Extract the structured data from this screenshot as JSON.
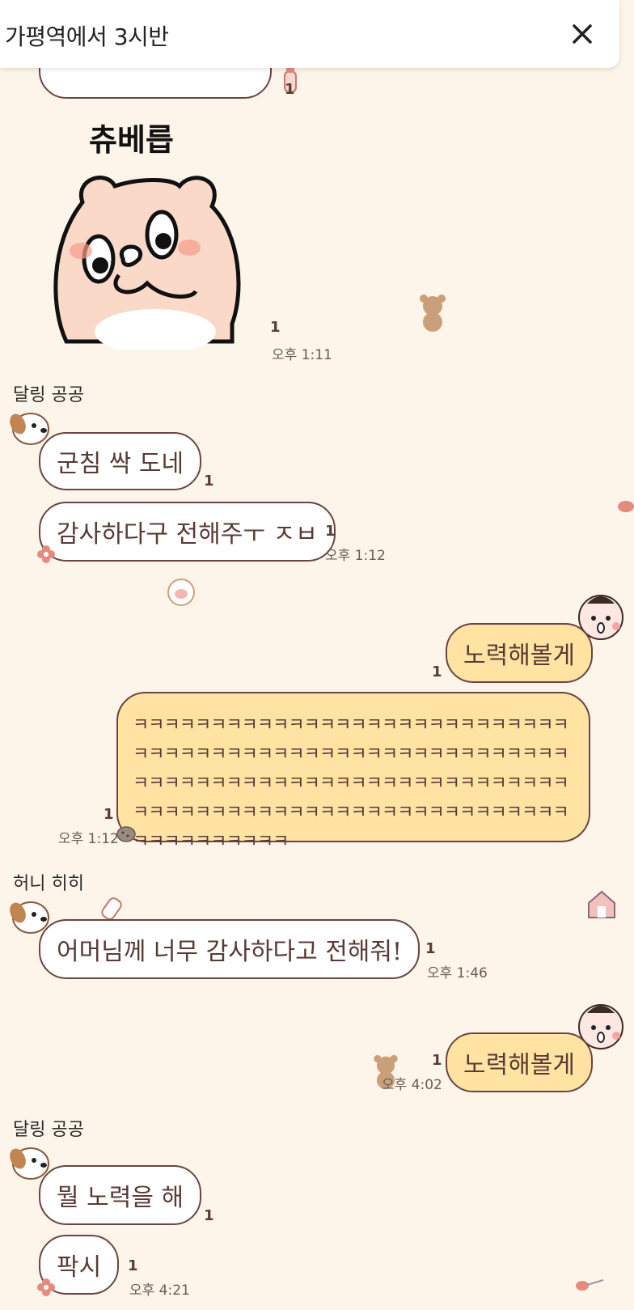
{
  "header": {
    "title": "가평역에서 3시반"
  },
  "sticker": {
    "caption": "츄베릅",
    "unread": "1",
    "time": "오후 1:11"
  },
  "messages": [
    {
      "sender": "달링 공공"
    },
    {
      "text": "군침 싹 도네",
      "unread": "1"
    },
    {
      "text": "감사하다구 전해주ㅜ ㅈㅂ",
      "unread": "1",
      "time": "오후 1:12"
    },
    {
      "text": "노력해볼게",
      "unread": "1"
    },
    {
      "text": "ㅋㅋㅋㅋㅋㅋㅋㅋㅋㅋㅋㅋㅋㅋㅋㅋㅋㅋㅋㅋㅋㅋㅋㅋㅋㅋㅋㅋㅋㅋㅋㅋㅋㅋㅋㅋㅋㅋㅋㅋㅋㅋㅋㅋㅋㅋㅋㅋㅋㅋㅋㅋㅋㅋㅋㅋㅋㅋㅋㅋㅋㅋㅋㅋㅋㅋㅋㅋㅋㅋㅋㅋㅋㅋㅋㅋㅋㅋㅋㅋㅋㅋㅋㅋㅋㅋㅋㅋㅋㅋㅋㅋㅋㅋㅋㅋㅋㅋㅋㅋㅋㅋㅋㅋㅋㅋㅋㅋㅋㅋㅋㅋㅋㅋㅋㅋㅋㅋㅋㅋㅋㅋ",
      "unread": "1",
      "time": "오후 1:12"
    },
    {
      "sender": "허니 히히"
    },
    {
      "text": "어머님께 너무 감사하다고 전해줘!",
      "unread": "1",
      "time": "오후 1:46"
    },
    {
      "text": "노력해볼게",
      "unread": "1",
      "time": "오후 4:02"
    },
    {
      "sender": "달링 공공"
    },
    {
      "text": "뭘 노력을 해",
      "unread": "1"
    },
    {
      "text": "팍시",
      "unread": "1",
      "time": "오후 4:21"
    }
  ],
  "colors": {
    "background": "#fdf5e9",
    "bubble_mine": "#ffe3a3",
    "bubble_other": "#ffffff",
    "border": "#6b4540"
  }
}
